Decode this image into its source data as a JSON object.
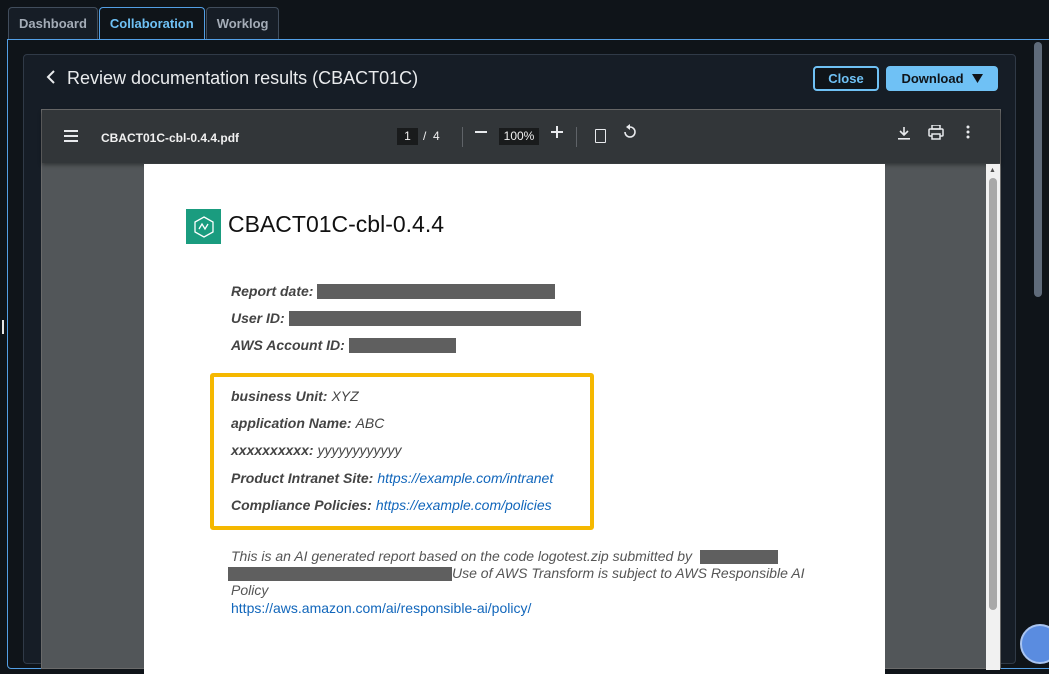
{
  "tabs": [
    {
      "label": "Dashboard",
      "active": false
    },
    {
      "label": "Collaboration",
      "active": true
    },
    {
      "label": "Worklog",
      "active": false
    }
  ],
  "header": {
    "back_icon": "chevron-left-icon",
    "title": "Review documentation results  (CBACT01C)"
  },
  "actions": {
    "close_label": "Close",
    "download_label": "Download",
    "download_icon": "caret-down-icon"
  },
  "pdf_toolbar": {
    "filename": "CBACT01C-cbl-0.4.4.pdf",
    "page_current": "1",
    "page_separator": "/",
    "page_total": "4",
    "zoom": "100%"
  },
  "document": {
    "title": "CBACT01C-cbl-0.4.4",
    "fields": [
      {
        "label": "Report date:",
        "redacted": true
      },
      {
        "label": "User ID:",
        "redacted": true
      },
      {
        "label": "AWS Account ID:",
        "redacted": true
      }
    ],
    "highlighted_fields": [
      {
        "label": "business Unit:",
        "value": "XYZ"
      },
      {
        "label": "application Name:",
        "value": "ABC"
      },
      {
        "label": "xxxxxxxxxx:",
        "value": "yyyyyyyyyyyy"
      },
      {
        "label": "Product Intranet Site:",
        "link": "https://example.com/intranet"
      },
      {
        "label": "Compliance Policies:",
        "link": "https://example.com/policies"
      }
    ],
    "disclaimer_part1": "This is an AI generated report based on the code logotest.zip submitted by",
    "disclaimer_part2": "Use of AWS Transform is subject to AWS Responsible AI",
    "disclaimer_part3": "Policy",
    "disclaimer_link": "https://aws.amazon.com/ai/responsible-ai/policy/"
  },
  "colors": {
    "accent": "#6fc1f5",
    "highlight_border": "#f5b800",
    "link": "#1166bb",
    "logo_bg": "#1a9c7f"
  }
}
